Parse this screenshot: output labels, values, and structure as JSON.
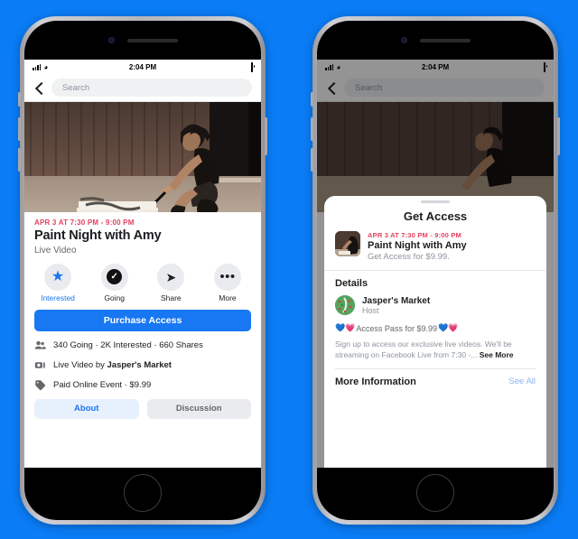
{
  "background_color": "#0a7cf5",
  "phones": {
    "left": {
      "name": "event-detail-screen",
      "status_bar": {
        "time": "2:04 PM",
        "signal_icon": "cellular-bars-icon",
        "wifi_icon": "wifi-icon",
        "battery_icon": "battery-full-icon"
      },
      "navbar": {
        "back_icon": "back-chevron-icon",
        "search_placeholder": "Search"
      },
      "hero": {
        "alt": "person-crouching-painting-canvas-photo"
      },
      "event": {
        "date": "APR 3 AT 7:30 PM - 9:00 PM",
        "title": "Paint Night with Amy",
        "subtitle": "Live Video"
      },
      "actions": [
        {
          "icon": "star-icon",
          "label": "Interested",
          "accent": true
        },
        {
          "icon": "check-circle-icon",
          "label": "Going",
          "accent": false
        },
        {
          "icon": "share-arrow-icon",
          "label": "Share",
          "accent": false
        },
        {
          "icon": "ellipsis-icon",
          "label": "More",
          "accent": false
        }
      ],
      "cta_label": "Purchase Access",
      "info_rows": [
        {
          "icon": "people-icon",
          "text": "340 Going · 2K Interested · 660 Shares"
        },
        {
          "icon": "video-camera-icon",
          "text_prefix": "Live Video by ",
          "text_bold": "Jasper's Market"
        },
        {
          "icon": "ticket-icon",
          "text": "Paid Online Event · $9.99"
        }
      ],
      "tabs": [
        {
          "label": "About",
          "active": true
        },
        {
          "label": "Discussion",
          "active": false
        }
      ]
    },
    "right": {
      "name": "get-access-sheet-screen",
      "status_bar": {
        "time": "2:04 PM",
        "signal_icon": "cellular-bars-icon",
        "wifi_icon": "wifi-icon",
        "battery_icon": "battery-full-icon"
      },
      "navbar": {
        "back_icon": "back-chevron-icon",
        "search_placeholder": "Search"
      },
      "sheet": {
        "title": "Get Access",
        "event": {
          "thumb_alt": "event-thumbnail-painting",
          "date": "APR 3 AT 7:30 PM - 9:00 PM",
          "title": "Paint Night with Amy",
          "price_line": "Get Access for $9.99."
        },
        "details_heading": "Details",
        "host": {
          "avatar_alt": "jaspers-market-avatar",
          "name": "Jasper's Market",
          "role": "Host"
        },
        "pass_line": {
          "emoji_left": "💙💗",
          "text": "Access Pass for $9.99",
          "emoji_right": "💙💗"
        },
        "description": "Sign up to access our exclusive live videos. We'll be streaming on Facebook Live from 7:30 -...",
        "see_more_label": "See More",
        "more_info_heading": "More Information",
        "see_all_label": "See All"
      }
    }
  }
}
